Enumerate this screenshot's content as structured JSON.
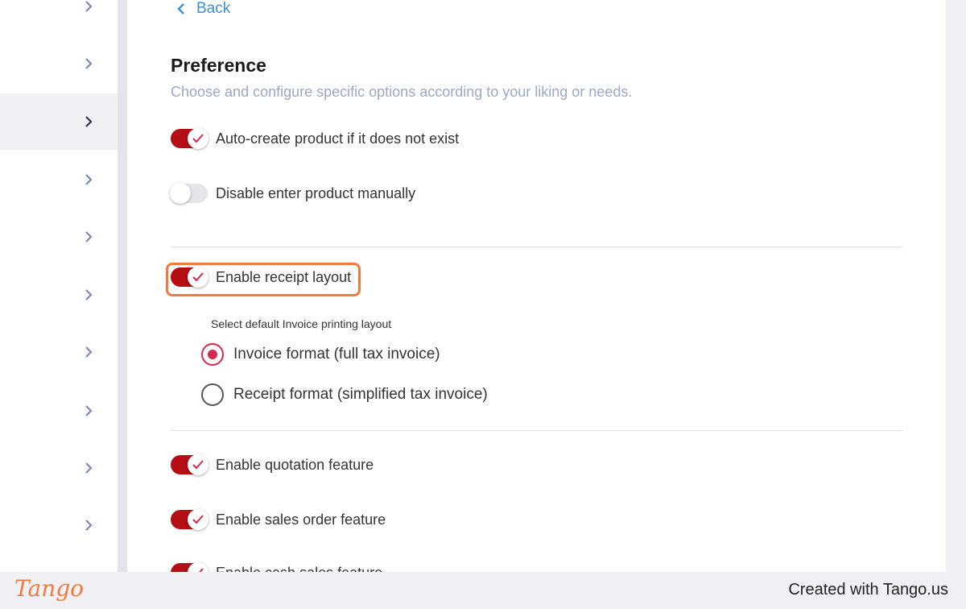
{
  "back": {
    "label": "Back"
  },
  "page": {
    "title": "Preference",
    "subtitle": "Choose and configure specific options according to your liking or needs."
  },
  "options": {
    "auto_create": {
      "label": "Auto-create product if it does not exist",
      "enabled": true
    },
    "disable_manual": {
      "label": "Disable enter product manually",
      "enabled": false
    },
    "receipt_layout": {
      "label": "Enable receipt layout",
      "enabled": true
    },
    "quotation": {
      "label": "Enable quotation feature",
      "enabled": true
    },
    "sales_order": {
      "label": "Enable sales order feature",
      "enabled": true
    },
    "cash_sales": {
      "label": "Enable cash sales feature",
      "enabled": true
    }
  },
  "invoice_layout": {
    "label": "Select default Invoice printing layout",
    "options": [
      {
        "label": "Invoice format (full tax invoice)",
        "selected": true
      },
      {
        "label": "Receipt format (simplified tax invoice)",
        "selected": false
      }
    ]
  },
  "colors": {
    "toggle_on": "#b50e14",
    "link": "#3c8fd6",
    "radio_checked": "#d42a4e",
    "highlight": "#f07a3d"
  },
  "footer": {
    "brand": "Tango",
    "credit": "Created with Tango.us"
  }
}
